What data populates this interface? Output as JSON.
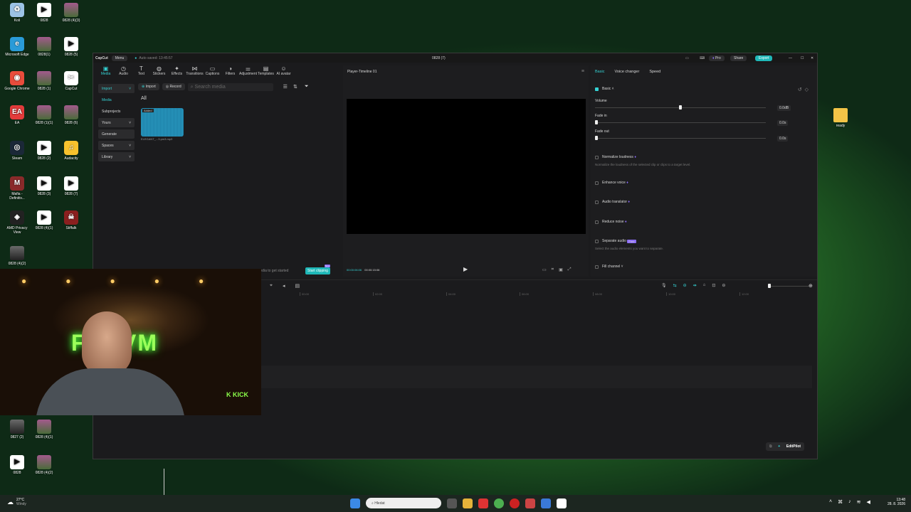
{
  "desktop": {
    "left_icons": [
      {
        "label": "Koš",
        "icon": "recycle-bin-icon"
      },
      {
        "label": "0828",
        "icon": "video-play-icon"
      },
      {
        "label": "0828 (4)(3)",
        "icon": "video-thumbnail-icon"
      },
      {
        "label": "Microsoft Edge",
        "icon": "edge-icon"
      },
      {
        "label": "0828(1)",
        "icon": "video-thumbnail-icon"
      },
      {
        "label": "0828 (5)",
        "icon": "video-play-icon"
      },
      {
        "label": "Google Chrome",
        "icon": "chrome-icon"
      },
      {
        "label": "0828 (1)",
        "icon": "video-thumbnail-icon"
      },
      {
        "label": "CapCut",
        "icon": "capcut-icon"
      },
      {
        "label": "EA",
        "icon": "ea-icon"
      },
      {
        "label": "0828 (1)(1)",
        "icon": "video-thumbnail-icon"
      },
      {
        "label": "0828 (6)",
        "icon": "video-thumbnail-icon"
      },
      {
        "label": "Steam",
        "icon": "steam-icon"
      },
      {
        "label": "0828 (2)",
        "icon": "video-play-icon"
      },
      {
        "label": "Audacity",
        "icon": "audacity-icon"
      },
      {
        "label": "Mafia - Definitiv...",
        "icon": "mafia-icon"
      },
      {
        "label": "0828 (3)",
        "icon": "video-play-icon"
      },
      {
        "label": "0828 (7)",
        "icon": "video-play-icon"
      },
      {
        "label": "AMD Privacy View",
        "icon": "amd-icon"
      },
      {
        "label": "0828 (4)(1)",
        "icon": "video-play-icon"
      },
      {
        "label": "Stiffalk",
        "icon": "game-icon"
      },
      {
        "label": "0828 (4)(2)",
        "icon": "video-phone-icon"
      }
    ],
    "bottom_icons": [
      {
        "label": "0827 (2)",
        "icon": "video-phone-icon"
      },
      {
        "label": "0828 (4)(1)",
        "icon": "video-thumbnail-icon"
      },
      {
        "label": "0828",
        "icon": "video-play-icon"
      },
      {
        "label": "0828 (4)(2)",
        "icon": "video-thumbnail-icon"
      }
    ],
    "right_icon": {
      "label": "ready",
      "icon": "folder-icon"
    }
  },
  "app": {
    "logo": "CapCut",
    "menu": "Menu",
    "autosave": "Auto saved: 13:45:57",
    "title": "0828 (7)",
    "pro": "Pro",
    "share": "Share",
    "export": "Export",
    "tools": [
      "Media",
      "Audio",
      "Text",
      "Stickers",
      "Effects",
      "Transitions",
      "Captions",
      "Filters",
      "Adjustment",
      "Templates",
      "AI avatar"
    ],
    "left_nav": [
      "Import",
      "Media",
      "Subprojects",
      "Yours",
      "Generate",
      "Spaces",
      "Library"
    ],
    "media": {
      "import_btn": "Import",
      "record_btn": "Record",
      "search_placeholder": "Search media",
      "filter_all": "All",
      "clip_badge": "Added",
      "clip_name": "ELEGANT_...3.pm3.mp3",
      "hint": "Drag media to get started",
      "start_clipping": "Start clipping",
      "new_badge": "New"
    },
    "player": {
      "title": "Player-Timeline 01",
      "time_current": "00:00:06:06",
      "time_total": "00:00:15:06"
    },
    "details": {
      "tabs": [
        "Basic",
        "Voice changer",
        "Speed"
      ],
      "section": "Basic",
      "volume_label": "Volume",
      "volume_value": "0.0dB",
      "volume_level": 0.5,
      "fadein_label": "Fade in",
      "fadein_value": "0.0s",
      "fadeout_label": "Fade out",
      "fadeout_value": "0.0s",
      "normalize": "Normalize loudness",
      "normalize_desc": "Normalize the loudness of the selected clip or clips to a target level.",
      "enhance": "Enhance voice",
      "translator": "Audio translator",
      "reduce": "Reduce noise",
      "separate": "Separate audio",
      "separate_badge": "Free",
      "separate_desc": "Select the audio elements you want to separate.",
      "fill": "Fill channel"
    },
    "timeline": {
      "ticks": [
        "00:00",
        "02:00",
        "04:00",
        "06:00",
        "08:00",
        "10:00",
        "12:00"
      ],
      "editpilot": "EditPilot"
    }
  },
  "webcam": {
    "neon_text": "FENVM",
    "sign": "K KICK"
  },
  "taskbar": {
    "weather_temp": "27°C",
    "weather_desc": "Windy",
    "search_placeholder": "Hledat",
    "time": "13:48",
    "date": "28. 8. 2026"
  },
  "colors": {
    "accent": "#35d2d4",
    "export": "#1fb8b8",
    "purple": "#8b6cf5"
  }
}
